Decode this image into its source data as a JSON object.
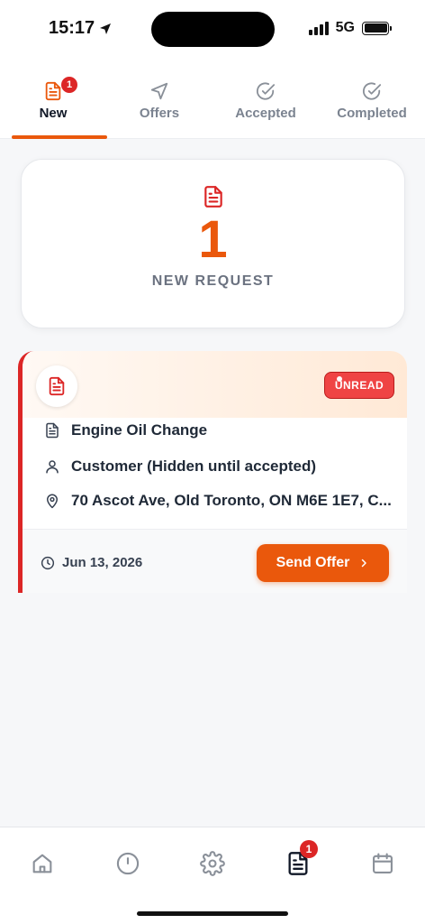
{
  "status_bar": {
    "time": "15:17",
    "network": "5G"
  },
  "tabs": [
    {
      "label": "New",
      "badge": "1",
      "active": true,
      "icon": "document-icon"
    },
    {
      "label": "Offers",
      "active": false,
      "icon": "send-icon"
    },
    {
      "label": "Accepted",
      "active": false,
      "icon": "check-circle-icon"
    },
    {
      "label": "Completed",
      "active": false,
      "icon": "check-circle-icon"
    }
  ],
  "summary": {
    "count": "1",
    "label": "NEW REQUEST"
  },
  "request": {
    "status_badge": "UNREAD",
    "service": "Engine Oil Change",
    "customer": "Customer (Hidden until accepted)",
    "address": "70 Ascot Ave, Old Toronto, ON M6E 1E7, C...",
    "date": "Jun 13, 2026",
    "action_label": "Send Offer"
  },
  "bottom_nav": {
    "items": [
      "home-icon",
      "clock-icon",
      "gear-icon",
      "document-icon",
      "calendar-icon"
    ],
    "requests_badge": "1"
  },
  "colors": {
    "accent": "#ea580c",
    "alert": "#dc2626",
    "text": "#1f2937",
    "muted": "#7b8390"
  }
}
